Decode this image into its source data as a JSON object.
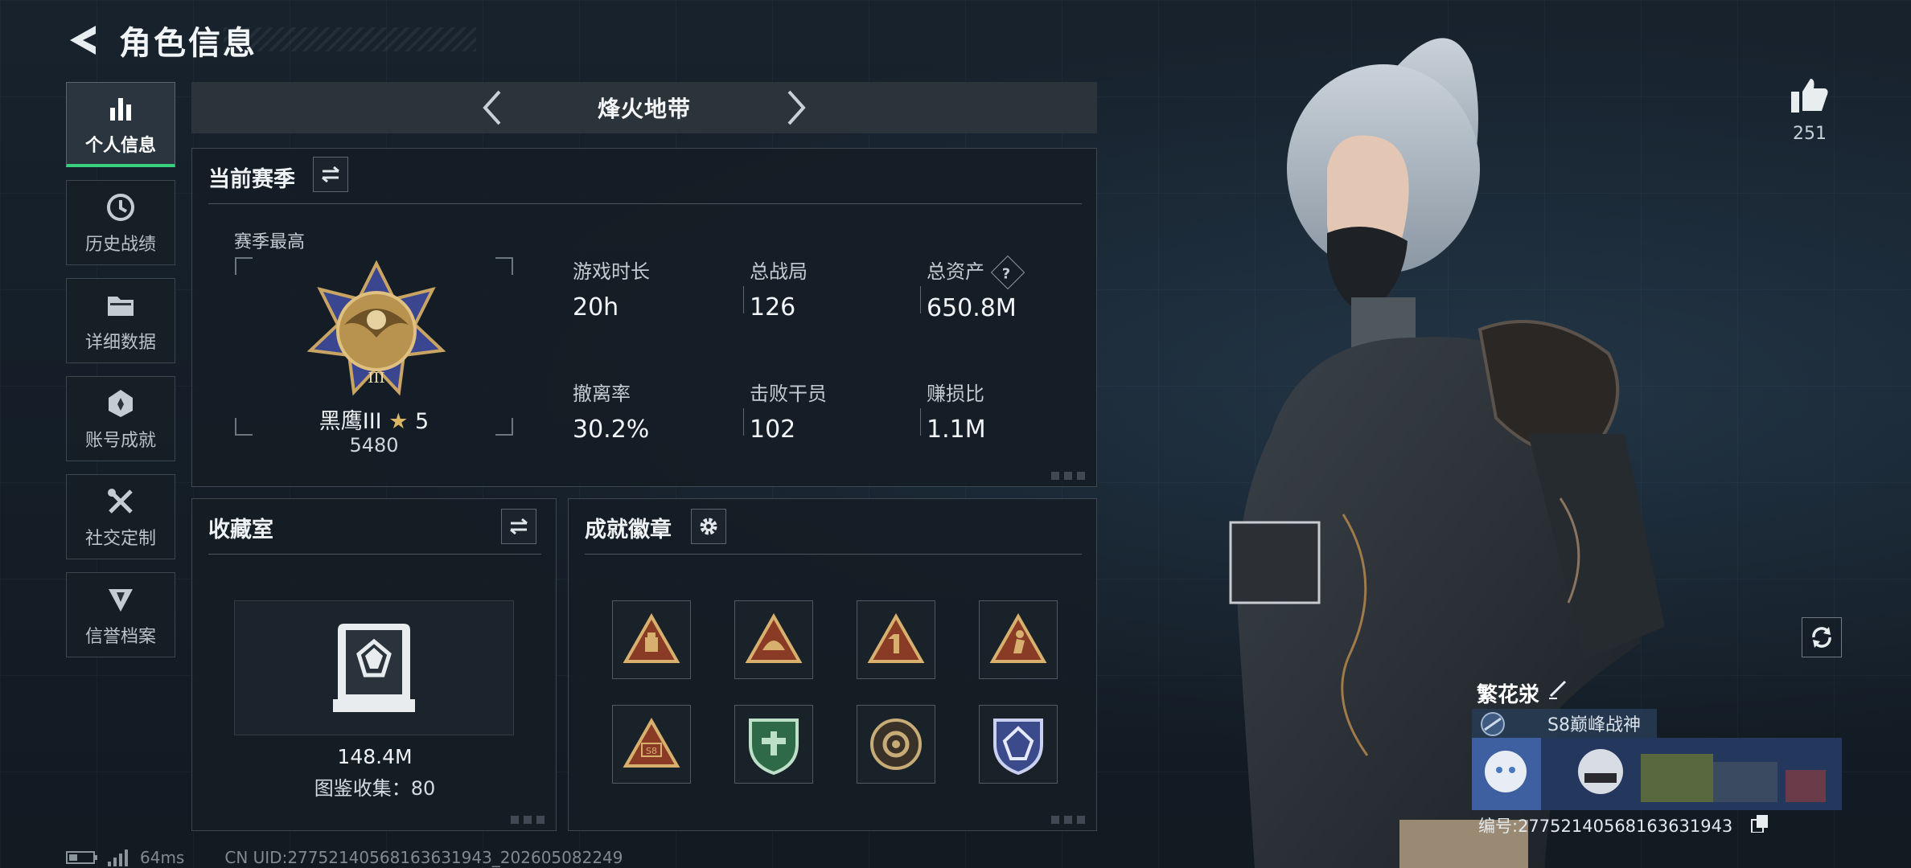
{
  "header": {
    "title": "角色信息"
  },
  "sidebar": {
    "items": [
      {
        "label": "个人信息",
        "icon": "bar-chart-icon",
        "active": true
      },
      {
        "label": "历史战绩",
        "icon": "history-clock-icon",
        "active": false
      },
      {
        "label": "详细数据",
        "icon": "folder-icon",
        "active": false
      },
      {
        "label": "账号成就",
        "icon": "achievement-medal-icon",
        "active": false
      },
      {
        "label": "社交定制",
        "icon": "wrench-screwdriver-icon",
        "active": false
      },
      {
        "label": "信誉档案",
        "icon": "credit-shield-icon",
        "active": false
      }
    ]
  },
  "season_bar": {
    "name": "烽火地带"
  },
  "season_panel": {
    "title": "当前赛季",
    "best_label": "赛季最高",
    "rank": {
      "name": "黑鹰III",
      "stars": "5",
      "score": "5480"
    },
    "stats": [
      {
        "label": "游戏时长",
        "value": "20h"
      },
      {
        "label": "总战局",
        "value": "126"
      },
      {
        "label": "总资产",
        "value": "650.8M",
        "help": "?"
      },
      {
        "label": "撤离率",
        "value": "30.2%"
      },
      {
        "label": "击败干员",
        "value": "102"
      },
      {
        "label": "赚损比",
        "value": "1.1M"
      }
    ]
  },
  "collection_panel": {
    "title": "收藏室",
    "value": "148.4M",
    "collect_label": "图鉴收集：",
    "collect_count": "80"
  },
  "achievement_panel": {
    "title": "成就徽章",
    "badges": [
      {
        "icon": "triangle-crate-badge-icon",
        "color": "#c9a463"
      },
      {
        "icon": "triangle-helmet-badge-icon",
        "color": "#c9a463"
      },
      {
        "icon": "triangle-number-one-badge-icon",
        "color": "#c9a463"
      },
      {
        "icon": "triangle-figure-badge-icon",
        "color": "#c9a463"
      },
      {
        "icon": "triangle-s8-badge-icon",
        "color": "#c9a463",
        "text": "S8"
      },
      {
        "icon": "green-shield-badge-icon",
        "color": "#3e8a5c"
      },
      {
        "icon": "bronze-disc-badge-icon",
        "color": "#b59a6a"
      },
      {
        "icon": "blue-shield-badge-icon",
        "color": "#5a6fb0"
      }
    ]
  },
  "like": {
    "count": "251"
  },
  "player": {
    "name": "繁花泶",
    "title": "S8巅峰战神",
    "id_text": "编号:27752140568163631943"
  },
  "footer": {
    "ping": "64ms",
    "uid": "CN UID:27752140568163631943_202605082249"
  },
  "colors": {
    "accent_green": "#38d07d",
    "panel_bg": "#141c24",
    "gold": "#c9a463"
  }
}
